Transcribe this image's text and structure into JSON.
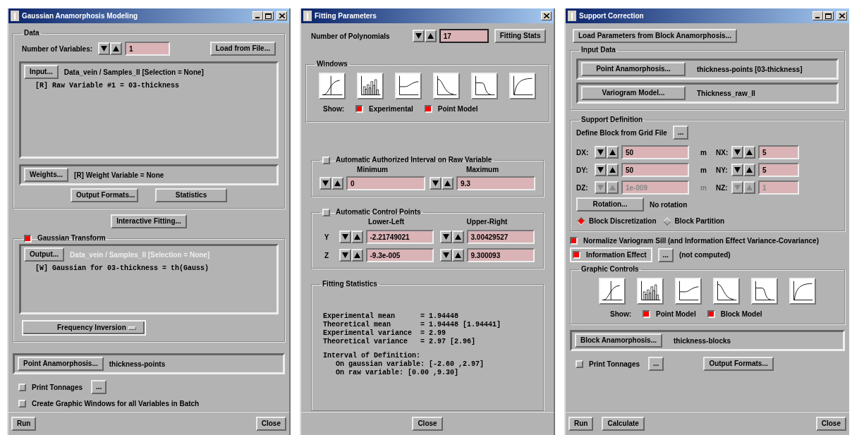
{
  "windows": [
    {
      "kind": "anamorphosis",
      "title": "Gaussian Anamorphosis Modeling",
      "maximizable": true,
      "data": {
        "title": "Data",
        "num_label": "Number of Variables:",
        "num_value": "1",
        "load_button": "Load from File...",
        "input_button": "Input...",
        "input_file": "Data_vein / Samples_II [Selection = None]",
        "variables": [
          "[R] Raw Variable #1 = 03-thickness"
        ],
        "weights_button": "Weights...",
        "weights_text": "[R] Weight Variable = None",
        "buttons": [
          "Output Formats...",
          "Statistics"
        ]
      },
      "interactive_button": "Interactive Fitting...",
      "transform": {
        "title": "Gaussian Transform",
        "checked": true,
        "output_button": "Output...",
        "output_file": "Data_vein / Samples_II [Selection = None]",
        "output_dimmed": true,
        "variables": [
          "[W] Gaussian for 03-thickness = th(Gauss)"
        ],
        "option": "Frequency Inversion"
      },
      "point_button": "Point Anamorphosis...",
      "point_text": "thickness-points",
      "options": [
        {
          "label": "Print Tonnages",
          "checked": false,
          "more": "..."
        },
        {
          "label": "Create Graphic Windows for all Variables in Batch",
          "checked": false
        }
      ],
      "footer": [
        "Run",
        "Close"
      ]
    },
    {
      "kind": "fitting",
      "title": "Fitting Parameters",
      "maximizable": false,
      "poly_label": "Number of Polynomials",
      "poly_value": "17",
      "stats_button": "Fitting Stats",
      "graphics": {
        "title": "Windows",
        "show_label": "Show:",
        "show": [
          {
            "label": "Experimental",
            "checked": true
          },
          {
            "label": "Point Model",
            "checked": true
          }
        ]
      },
      "interval": {
        "title": "Automatic Authorized Interval on Raw Variable",
        "checked": false,
        "columns": [
          "Minimum",
          "Maximum"
        ],
        "values": [
          "0",
          "9.3"
        ]
      },
      "control_points": {
        "title": "Automatic Control Points",
        "checked": false,
        "columns": [
          "Lower-Left",
          "Upper-Right"
        ],
        "rows": [
          {
            "label": "Y",
            "values": [
              "-2.21749021",
              "3.00429527"
            ]
          },
          {
            "label": "Z",
            "values": [
              "-9.3e-005",
              "9.300093"
            ]
          }
        ]
      },
      "statistics": {
        "title": "Fitting Statistics",
        "lines": [
          "Experimental mean      = 1.94448",
          "Theoretical mean       = 1.94448 [1.94441]",
          "Experimental variance  = 2.99",
          "Theoretical variance   = 2.97 [2.96]"
        ],
        "interval_lines": [
          "Interval of Definition:",
          "   On gaussian variable: [-2.60 ,2.97]",
          "   On raw variable: [0.00 ,9.30]"
        ]
      },
      "footer": [
        "Close"
      ]
    },
    {
      "kind": "support",
      "title": "Support Correction",
      "maximizable": true,
      "load_button": "Load Parameters from Block Anamorphosis...",
      "input": {
        "title": "Input Data",
        "rows": [
          {
            "button": "Point Anamorphosis...",
            "text": "thickness-points [03-thickness]"
          },
          {
            "button": "Variogram Model...",
            "text": "Thickness_raw_II"
          }
        ]
      },
      "support": {
        "title": "Support Definition",
        "grid_label": "Define Block from Grid File",
        "grid_button": "...",
        "dims": [
          {
            "d_label": "DX:",
            "d_value": "50",
            "unit": "m",
            "n_label": "NX:",
            "n_value": "5",
            "disabled": false
          },
          {
            "d_label": "DY:",
            "d_value": "50",
            "unit": "m",
            "n_label": "NY:",
            "n_value": "5",
            "disabled": false
          },
          {
            "d_label": "DZ:",
            "d_value": "1e-009",
            "unit": "m",
            "n_label": "NZ:",
            "n_value": "1",
            "disabled": true
          }
        ],
        "rotation_button": "Rotation...",
        "rotation_text": "No rotation",
        "modes": [
          {
            "label": "Block Discretization",
            "selected": true
          },
          {
            "label": "Block Partition",
            "selected": false
          }
        ]
      },
      "normalize": {
        "label": "Normalize Variogram Sill (and Information Effect Variance-Covariance)",
        "checked": true
      },
      "info_effect": {
        "label": "Information Effect",
        "checked": true,
        "button": "...",
        "status": "(not computed)"
      },
      "graphics": {
        "title": "Graphic Controls",
        "show_label": "Show:",
        "show": [
          {
            "label": "Point Model",
            "checked": true
          },
          {
            "label": "Block Model",
            "checked": true
          }
        ]
      },
      "block_button": "Block Anamorphosis...",
      "block_text": "thickness-blocks",
      "print": {
        "label": "Print Tonnages",
        "checked": false,
        "button": "..."
      },
      "output_button": "Output Formats...",
      "footer": [
        "Run",
        "Calculate",
        "Close"
      ]
    }
  ]
}
